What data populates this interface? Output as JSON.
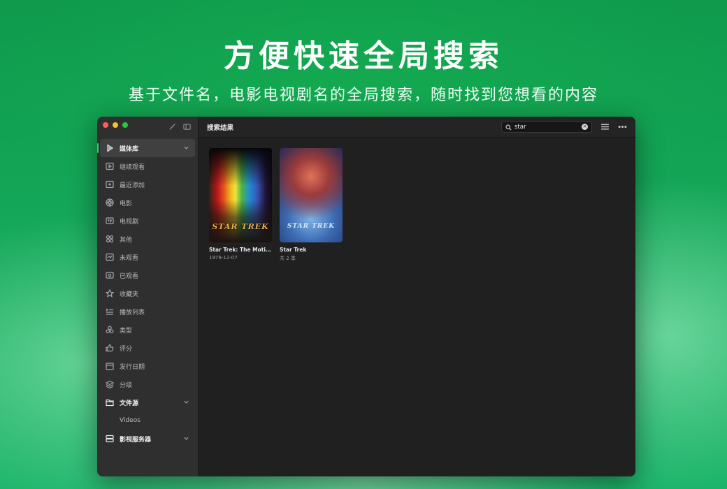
{
  "hero": {
    "title": "方便快速全局搜索",
    "subtitle": "基于文件名，电影电视剧名的全局搜索，随时找到您想看的内容"
  },
  "sidebar": {
    "library_header": "媒体库",
    "items": [
      {
        "label": "继续观看",
        "icon": "play-square-icon"
      },
      {
        "label": "最近添加",
        "icon": "plus-square-icon"
      },
      {
        "label": "电影",
        "icon": "film-reel-icon"
      },
      {
        "label": "电视剧",
        "icon": "tv-icon"
      },
      {
        "label": "其他",
        "icon": "grid-icon"
      },
      {
        "label": "未观看",
        "icon": "unwatched-icon"
      },
      {
        "label": "已观看",
        "icon": "eye-icon"
      },
      {
        "label": "收藏夹",
        "icon": "star-icon"
      },
      {
        "label": "播放列表",
        "icon": "playlist-icon"
      },
      {
        "label": "类型",
        "icon": "genre-icon"
      },
      {
        "label": "评分",
        "icon": "thumbs-up-icon"
      },
      {
        "label": "发行日期",
        "icon": "calendar-icon"
      },
      {
        "label": "分级",
        "icon": "layers-icon"
      }
    ],
    "sources_header": "文件源",
    "sources_items": [
      {
        "label": "Videos"
      }
    ],
    "servers_header": "影视服务器"
  },
  "topbar": {
    "title": "搜索结果",
    "search_value": "star",
    "clear_symbol": "×"
  },
  "results": [
    {
      "title": "Star Trek: The Motion...",
      "subtitle": "1979-12-07",
      "poster_text": "STAR TREK"
    },
    {
      "title": "Star Trek",
      "subtitle": "共 2 季",
      "poster_text": "STAR TREK"
    }
  ],
  "colors": {
    "accent": "#2fd07a",
    "window_bg": "#202020",
    "sidebar_bg": "#2f2f2f"
  }
}
